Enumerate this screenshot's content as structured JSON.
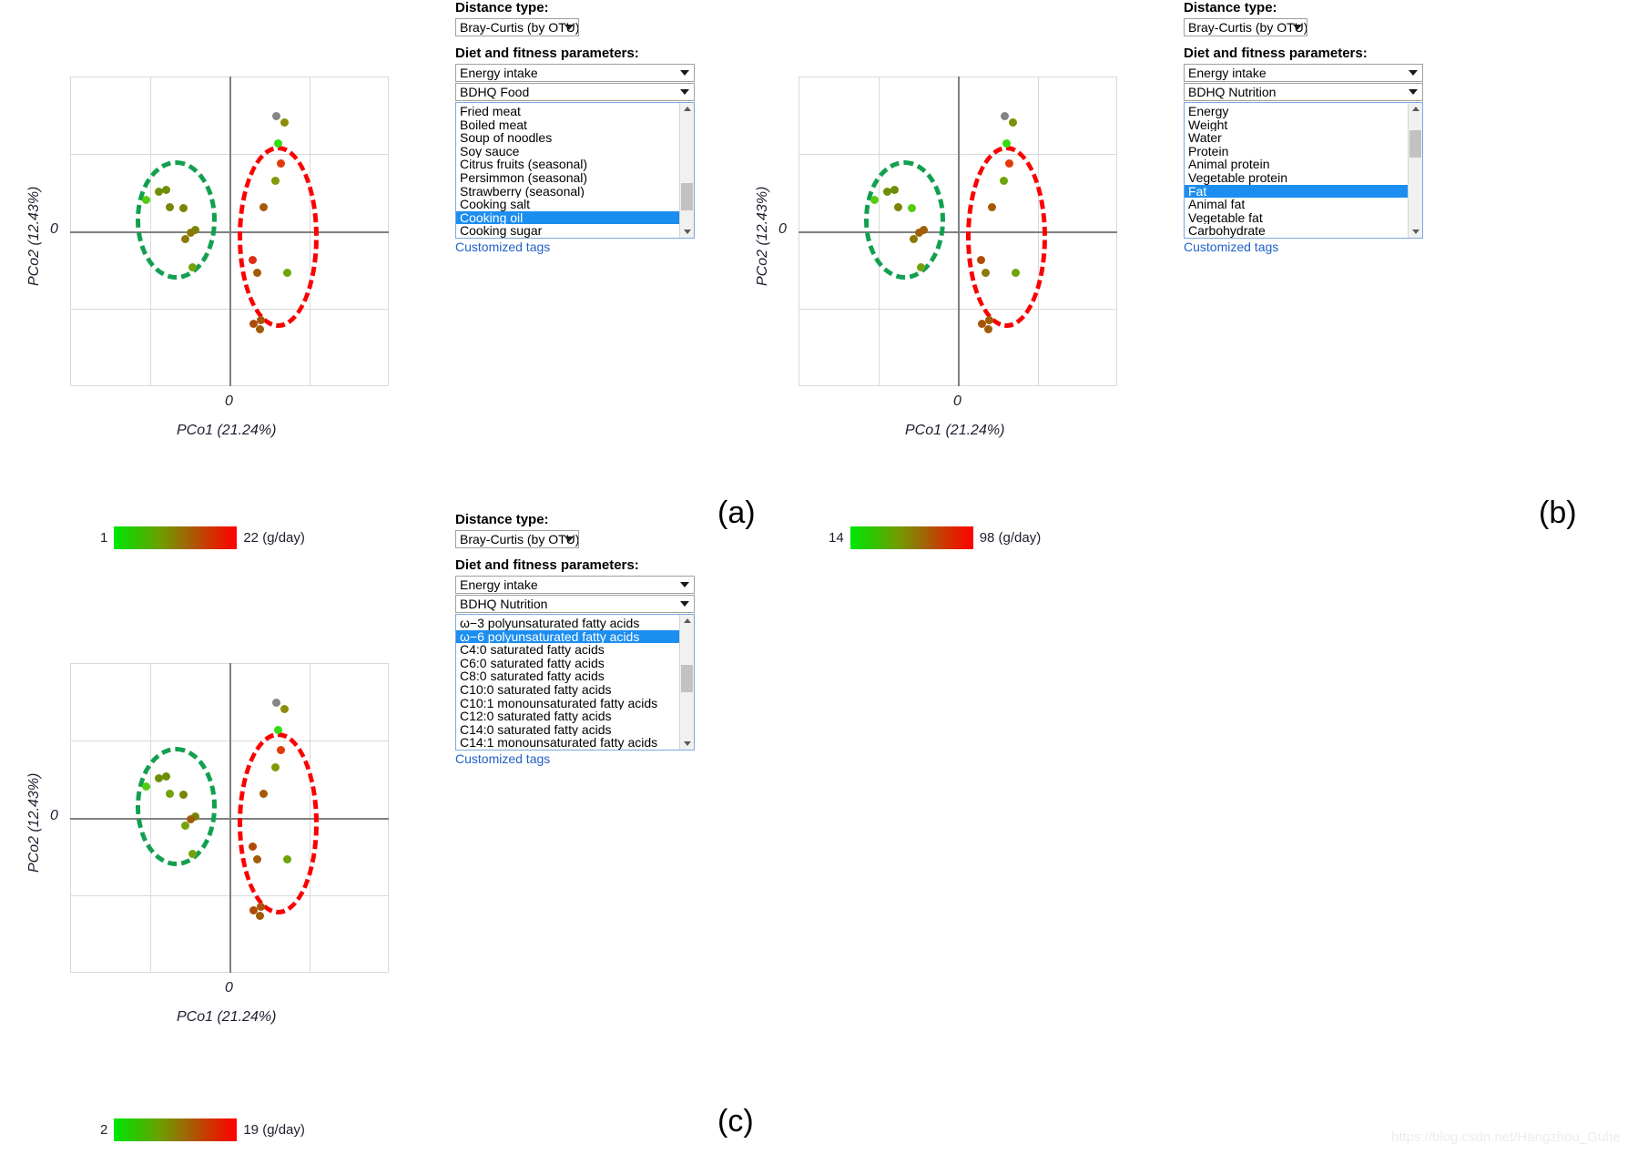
{
  "watermark": "https://blog.csdn.net/Hangzhou_Guhe",
  "labels": {
    "distance_type": "Distance type:",
    "diet_params": "Diet and fitness parameters:",
    "customized_tags": "Customized tags",
    "xlabel": "PCo1 (21.24%)",
    "ylabel": "PCo2 (12.43%)",
    "zero": "0"
  },
  "colors": {
    "green_group": "#12A050",
    "red_group": "#FB0000",
    "highlight": "#1C8EF0",
    "link": "#2161C9",
    "gradient_low": "#00E800",
    "gradient_high": "#FF0000"
  },
  "panels": [
    {
      "letter": "(a)",
      "controls": {
        "distance_value": "Bray-Curtis (by OTU)",
        "param_group": "Energy intake",
        "param_source": "BDHQ Food",
        "selected": "Cooking oil",
        "items": [
          "Fried meat",
          "Boiled meat",
          "Soup of noodles",
          "Soy sauce",
          "Citrus fruits (seasonal)",
          "Persimmon (seasonal)",
          "Strawberry (seasonal)",
          "Cooking salt",
          "Cooking oil",
          "Cooking sugar"
        ],
        "scroll_pos": 0.82
      },
      "legend": {
        "min": "1",
        "max": "22 (g/day)"
      },
      "chart_data": {
        "type": "scatter",
        "title": "",
        "xlabel": "PCo1 (21.24%)",
        "ylabel": "PCo2 (12.43%)",
        "xlim": [
          -1,
          1
        ],
        "ylim": [
          -1,
          1
        ],
        "grid": true,
        "legend_position": "below-plot",
        "colorbar": {
          "min": 1,
          "max": 22,
          "units": "g/day",
          "variable": "Cooking oil"
        },
        "groups": [
          {
            "name": "green-ellipse",
            "outline": "#12A050",
            "cx": -0.335,
            "cy": 0.075,
            "rx": 0.255,
            "ry": 0.385
          },
          {
            "name": "red-ellipse",
            "outline": "#FB0000",
            "cx": 0.305,
            "cy": -0.035,
            "rx": 0.255,
            "ry": 0.59
          }
        ],
        "points": [
          {
            "x": -0.525,
            "y": 0.205,
            "color": "#55CC11"
          },
          {
            "x": -0.445,
            "y": 0.255,
            "color": "#6E8E07"
          },
          {
            "x": -0.395,
            "y": 0.27,
            "color": "#6E8E07"
          },
          {
            "x": -0.375,
            "y": 0.155,
            "color": "#7A8406"
          },
          {
            "x": -0.29,
            "y": 0.15,
            "color": "#7A8406"
          },
          {
            "x": -0.215,
            "y": 0.01,
            "color": "#7A8406"
          },
          {
            "x": -0.245,
            "y": -0.01,
            "color": "#8A7A05"
          },
          {
            "x": -0.275,
            "y": -0.05,
            "color": "#8A7A05"
          },
          {
            "x": -0.23,
            "y": -0.235,
            "color": "#76A20B"
          },
          {
            "x": 0.295,
            "y": 0.745,
            "color": "#848484"
          },
          {
            "x": 0.345,
            "y": 0.705,
            "color": "#8C8C06"
          },
          {
            "x": 0.305,
            "y": 0.565,
            "color": "#33DD11"
          },
          {
            "x": 0.325,
            "y": 0.44,
            "color": "#E03A0B"
          },
          {
            "x": 0.29,
            "y": 0.325,
            "color": "#7E9A07"
          },
          {
            "x": 0.215,
            "y": 0.155,
            "color": "#A55A08"
          },
          {
            "x": 0.145,
            "y": -0.185,
            "color": "#DB2E14"
          },
          {
            "x": 0.175,
            "y": -0.27,
            "color": "#A05C08"
          },
          {
            "x": 0.36,
            "y": -0.265,
            "color": "#6EA30B"
          },
          {
            "x": 0.15,
            "y": -0.595,
            "color": "#B04C08"
          },
          {
            "x": 0.195,
            "y": -0.575,
            "color": "#A85408"
          },
          {
            "x": 0.19,
            "y": -0.635,
            "color": "#A05C08"
          }
        ]
      }
    },
    {
      "letter": "(b)",
      "controls": {
        "distance_value": "Bray-Curtis (by OTU)",
        "param_group": "Energy intake",
        "param_source": "BDHQ Nutrition",
        "selected": "Fat",
        "items": [
          "Energy",
          "Weight",
          "Water",
          "Protein",
          "Animal protein",
          "Vegetable protein",
          "Fat",
          "Animal fat",
          "Vegetable fat",
          "Carbohydrate"
        ],
        "scroll_pos": 0.18
      },
      "legend": {
        "min": "14",
        "max": "98 (g/day)"
      },
      "chart_data": {
        "type": "scatter",
        "title": "",
        "xlabel": "PCo1 (21.24%)",
        "ylabel": "PCo2 (12.43%)",
        "xlim": [
          -1,
          1
        ],
        "ylim": [
          -1,
          1
        ],
        "grid": true,
        "legend_position": "below-plot",
        "colorbar": {
          "min": 14,
          "max": 98,
          "units": "g/day",
          "variable": "Fat"
        },
        "groups": [
          {
            "name": "green-ellipse",
            "outline": "#12A050",
            "cx": -0.335,
            "cy": 0.075,
            "rx": 0.255,
            "ry": 0.385
          },
          {
            "name": "red-ellipse",
            "outline": "#FB0000",
            "cx": 0.305,
            "cy": -0.035,
            "rx": 0.255,
            "ry": 0.59
          }
        ],
        "points": [
          {
            "x": -0.525,
            "y": 0.205,
            "color": "#55CC11"
          },
          {
            "x": -0.445,
            "y": 0.255,
            "color": "#6E8E07"
          },
          {
            "x": -0.395,
            "y": 0.27,
            "color": "#6E8E07"
          },
          {
            "x": -0.375,
            "y": 0.155,
            "color": "#7A8406"
          },
          {
            "x": -0.29,
            "y": 0.15,
            "color": "#55CC11"
          },
          {
            "x": -0.215,
            "y": 0.01,
            "color": "#9C6006"
          },
          {
            "x": -0.245,
            "y": -0.01,
            "color": "#A05C08"
          },
          {
            "x": -0.275,
            "y": -0.05,
            "color": "#8A7A05"
          },
          {
            "x": -0.23,
            "y": -0.235,
            "color": "#76A20B"
          },
          {
            "x": 0.295,
            "y": 0.745,
            "color": "#848484"
          },
          {
            "x": 0.345,
            "y": 0.705,
            "color": "#7E9007"
          },
          {
            "x": 0.305,
            "y": 0.565,
            "color": "#33DD11"
          },
          {
            "x": 0.325,
            "y": 0.44,
            "color": "#E03A0B"
          },
          {
            "x": 0.29,
            "y": 0.325,
            "color": "#6EA30B"
          },
          {
            "x": 0.215,
            "y": 0.155,
            "color": "#A55A08"
          },
          {
            "x": 0.145,
            "y": -0.185,
            "color": "#B04C08"
          },
          {
            "x": 0.175,
            "y": -0.27,
            "color": "#8A7A05"
          },
          {
            "x": 0.36,
            "y": -0.265,
            "color": "#6EA30B"
          },
          {
            "x": 0.15,
            "y": -0.595,
            "color": "#A85408"
          },
          {
            "x": 0.195,
            "y": -0.575,
            "color": "#A05C08"
          },
          {
            "x": 0.19,
            "y": -0.635,
            "color": "#A05C08"
          }
        ]
      }
    },
    {
      "letter": "(c)",
      "controls": {
        "distance_value": "Bray-Curtis (by OTU)",
        "param_group": "Energy intake",
        "param_source": "BDHQ Nutrition",
        "selected": "ω−6 polyunsaturated fatty acids",
        "items": [
          "ω−3 polyunsaturated fatty acids",
          "ω−6 polyunsaturated fatty acids",
          "C4:0 saturated fatty acids",
          "C6:0 saturated fatty acids",
          "C8:0 saturated fatty acids",
          "C10:0 saturated fatty acids",
          "C10:1 monounsaturated fatty acids",
          "C12:0 saturated fatty acids",
          "C14:0 saturated fatty acids",
          "C14:1 monounsaturated fatty acids"
        ],
        "scroll_pos": 0.45
      },
      "legend": {
        "min": "2",
        "max": "19 (g/day)"
      },
      "chart_data": {
        "type": "scatter",
        "title": "",
        "xlabel": "PCo1 (21.24%)",
        "ylabel": "PCo2 (12.43%)",
        "xlim": [
          -1,
          1
        ],
        "ylim": [
          -1,
          1
        ],
        "grid": true,
        "legend_position": "below-plot",
        "colorbar": {
          "min": 2,
          "max": 19,
          "units": "g/day",
          "variable": "ω−6 polyunsaturated fatty acids"
        },
        "groups": [
          {
            "name": "green-ellipse",
            "outline": "#12A050",
            "cx": -0.335,
            "cy": 0.075,
            "rx": 0.255,
            "ry": 0.385
          },
          {
            "name": "red-ellipse",
            "outline": "#FB0000",
            "cx": 0.305,
            "cy": -0.035,
            "rx": 0.255,
            "ry": 0.59
          }
        ],
        "points": [
          {
            "x": -0.525,
            "y": 0.205,
            "color": "#55CC11"
          },
          {
            "x": -0.445,
            "y": 0.255,
            "color": "#6E8E07"
          },
          {
            "x": -0.395,
            "y": 0.27,
            "color": "#6E8E07"
          },
          {
            "x": -0.375,
            "y": 0.155,
            "color": "#6EA30B"
          },
          {
            "x": -0.29,
            "y": 0.15,
            "color": "#7A8406"
          },
          {
            "x": -0.215,
            "y": 0.01,
            "color": "#7A8406"
          },
          {
            "x": -0.245,
            "y": -0.01,
            "color": "#A05C08"
          },
          {
            "x": -0.275,
            "y": -0.05,
            "color": "#76A20B"
          },
          {
            "x": -0.23,
            "y": -0.235,
            "color": "#76A20B"
          },
          {
            "x": 0.295,
            "y": 0.745,
            "color": "#848484"
          },
          {
            "x": 0.345,
            "y": 0.705,
            "color": "#8C8C06"
          },
          {
            "x": 0.305,
            "y": 0.565,
            "color": "#33DD11"
          },
          {
            "x": 0.325,
            "y": 0.44,
            "color": "#E03A0B"
          },
          {
            "x": 0.29,
            "y": 0.325,
            "color": "#7E9A07"
          },
          {
            "x": 0.215,
            "y": 0.155,
            "color": "#A55A08"
          },
          {
            "x": 0.145,
            "y": -0.185,
            "color": "#B04C08"
          },
          {
            "x": 0.175,
            "y": -0.27,
            "color": "#A05C08"
          },
          {
            "x": 0.36,
            "y": -0.265,
            "color": "#6EA30B"
          },
          {
            "x": 0.15,
            "y": -0.595,
            "color": "#B04C08"
          },
          {
            "x": 0.195,
            "y": -0.575,
            "color": "#A85408"
          },
          {
            "x": 0.19,
            "y": -0.635,
            "color": "#A05C08"
          }
        ]
      }
    }
  ]
}
